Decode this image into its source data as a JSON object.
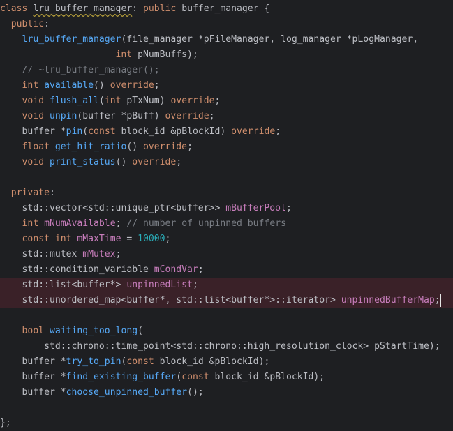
{
  "colors": {
    "background": "#1e1f22",
    "highlight_line": "#3a2128",
    "keyword": "#cf8e6d",
    "function": "#56a8f5",
    "field": "#c77dbb",
    "number": "#2aacb8",
    "comment": "#7a7e85",
    "plain": "#bcbec4"
  },
  "code": {
    "lines": [
      {
        "highlight": false,
        "tokens": [
          {
            "t": "class ",
            "k": "kw"
          },
          {
            "t": "lru_buffer_manager",
            "k": "plain",
            "u": true
          },
          {
            "t": ": ",
            "k": "plain"
          },
          {
            "t": "public ",
            "k": "kw"
          },
          {
            "t": "buffer_manager {",
            "k": "plain"
          }
        ]
      },
      {
        "highlight": false,
        "tokens": [
          {
            "t": "  ",
            "k": "plain"
          },
          {
            "t": "public",
            "k": "kw"
          },
          {
            "t": ":",
            "k": "plain"
          }
        ]
      },
      {
        "highlight": false,
        "tokens": [
          {
            "t": "    ",
            "k": "plain"
          },
          {
            "t": "lru_buffer_manager",
            "k": "fn"
          },
          {
            "t": "(file_manager *pFileManager, log_manager *pLogManager,",
            "k": "plain"
          }
        ]
      },
      {
        "highlight": false,
        "tokens": [
          {
            "t": "                     ",
            "k": "plain"
          },
          {
            "t": "int ",
            "k": "kw"
          },
          {
            "t": "pNumBuffs);",
            "k": "plain"
          }
        ]
      },
      {
        "highlight": false,
        "tokens": [
          {
            "t": "    ",
            "k": "plain"
          },
          {
            "t": "// ~lru_buffer_manager();",
            "k": "comment"
          }
        ]
      },
      {
        "highlight": false,
        "tokens": [
          {
            "t": "    ",
            "k": "plain"
          },
          {
            "t": "int ",
            "k": "kw"
          },
          {
            "t": "available",
            "k": "fn"
          },
          {
            "t": "() ",
            "k": "plain"
          },
          {
            "t": "override",
            "k": "kw"
          },
          {
            "t": ";",
            "k": "plain"
          }
        ]
      },
      {
        "highlight": false,
        "tokens": [
          {
            "t": "    ",
            "k": "plain"
          },
          {
            "t": "void ",
            "k": "kw"
          },
          {
            "t": "flush_all",
            "k": "fn"
          },
          {
            "t": "(",
            "k": "plain"
          },
          {
            "t": "int ",
            "k": "kw"
          },
          {
            "t": "pTxNum) ",
            "k": "plain"
          },
          {
            "t": "override",
            "k": "kw"
          },
          {
            "t": ";",
            "k": "plain"
          }
        ]
      },
      {
        "highlight": false,
        "tokens": [
          {
            "t": "    ",
            "k": "plain"
          },
          {
            "t": "void ",
            "k": "kw"
          },
          {
            "t": "unpin",
            "k": "fn"
          },
          {
            "t": "(buffer *pBuff) ",
            "k": "plain"
          },
          {
            "t": "override",
            "k": "kw"
          },
          {
            "t": ";",
            "k": "plain"
          }
        ]
      },
      {
        "highlight": false,
        "tokens": [
          {
            "t": "    ",
            "k": "plain"
          },
          {
            "t": "buffer *",
            "k": "plain"
          },
          {
            "t": "pin",
            "k": "fn"
          },
          {
            "t": "(",
            "k": "plain"
          },
          {
            "t": "const ",
            "k": "kw"
          },
          {
            "t": "block_id &pBlockId) ",
            "k": "plain"
          },
          {
            "t": "override",
            "k": "kw"
          },
          {
            "t": ";",
            "k": "plain"
          }
        ]
      },
      {
        "highlight": false,
        "tokens": [
          {
            "t": "    ",
            "k": "plain"
          },
          {
            "t": "float ",
            "k": "kw"
          },
          {
            "t": "get_hit_ratio",
            "k": "fn"
          },
          {
            "t": "() ",
            "k": "plain"
          },
          {
            "t": "override",
            "k": "kw"
          },
          {
            "t": ";",
            "k": "plain"
          }
        ]
      },
      {
        "highlight": false,
        "tokens": [
          {
            "t": "    ",
            "k": "plain"
          },
          {
            "t": "void ",
            "k": "kw"
          },
          {
            "t": "print_status",
            "k": "fn"
          },
          {
            "t": "() ",
            "k": "plain"
          },
          {
            "t": "override",
            "k": "kw"
          },
          {
            "t": ";",
            "k": "plain"
          }
        ]
      },
      {
        "highlight": false,
        "tokens": []
      },
      {
        "highlight": false,
        "tokens": [
          {
            "t": "  ",
            "k": "plain"
          },
          {
            "t": "private",
            "k": "kw"
          },
          {
            "t": ":",
            "k": "plain"
          }
        ]
      },
      {
        "highlight": false,
        "tokens": [
          {
            "t": "    ",
            "k": "plain"
          },
          {
            "t": "std::vector<std::unique_ptr<buffer>> ",
            "k": "plain"
          },
          {
            "t": "mBufferPool",
            "k": "field"
          },
          {
            "t": ";",
            "k": "plain"
          }
        ]
      },
      {
        "highlight": false,
        "tokens": [
          {
            "t": "    ",
            "k": "plain"
          },
          {
            "t": "int ",
            "k": "kw"
          },
          {
            "t": "mNumAvailable",
            "k": "field"
          },
          {
            "t": "; ",
            "k": "plain"
          },
          {
            "t": "// number of unpinned buffers",
            "k": "comment"
          }
        ]
      },
      {
        "highlight": false,
        "tokens": [
          {
            "t": "    ",
            "k": "plain"
          },
          {
            "t": "const int ",
            "k": "kw"
          },
          {
            "t": "mMaxTime",
            "k": "field"
          },
          {
            "t": " = ",
            "k": "plain"
          },
          {
            "t": "10000",
            "k": "num"
          },
          {
            "t": ";",
            "k": "plain"
          }
        ]
      },
      {
        "highlight": false,
        "tokens": [
          {
            "t": "    ",
            "k": "plain"
          },
          {
            "t": "std::mutex ",
            "k": "plain"
          },
          {
            "t": "mMutex",
            "k": "field"
          },
          {
            "t": ";",
            "k": "plain"
          }
        ]
      },
      {
        "highlight": false,
        "tokens": [
          {
            "t": "    ",
            "k": "plain"
          },
          {
            "t": "std::condition_variable ",
            "k": "plain"
          },
          {
            "t": "mCondVar",
            "k": "field"
          },
          {
            "t": ";",
            "k": "plain"
          }
        ]
      },
      {
        "highlight": true,
        "tokens": [
          {
            "t": "    ",
            "k": "plain"
          },
          {
            "t": "std::list<buffer*> ",
            "k": "plain"
          },
          {
            "t": "unpinnedList",
            "k": "field"
          },
          {
            "t": ";",
            "k": "plain"
          }
        ]
      },
      {
        "highlight": true,
        "caret": true,
        "tokens": [
          {
            "t": "    ",
            "k": "plain"
          },
          {
            "t": "std::unordered_map<buffer*, std::list<buffer*>::iterator> ",
            "k": "plain"
          },
          {
            "t": "unpinnedBufferMap",
            "k": "field"
          },
          {
            "t": ";",
            "k": "plain"
          }
        ]
      },
      {
        "highlight": false,
        "tokens": []
      },
      {
        "highlight": false,
        "tokens": [
          {
            "t": "    ",
            "k": "plain"
          },
          {
            "t": "bool ",
            "k": "kw"
          },
          {
            "t": "waiting_too_long",
            "k": "fn"
          },
          {
            "t": "(",
            "k": "plain"
          }
        ]
      },
      {
        "highlight": false,
        "tokens": [
          {
            "t": "        ",
            "k": "plain"
          },
          {
            "t": "std::chrono::time_point<std::chrono::high_resolution_clock> pStartTime);",
            "k": "plain"
          }
        ]
      },
      {
        "highlight": false,
        "tokens": [
          {
            "t": "    ",
            "k": "plain"
          },
          {
            "t": "buffer *",
            "k": "plain"
          },
          {
            "t": "try_to_pin",
            "k": "fn"
          },
          {
            "t": "(",
            "k": "plain"
          },
          {
            "t": "const ",
            "k": "kw"
          },
          {
            "t": "block_id &pBlockId);",
            "k": "plain"
          }
        ]
      },
      {
        "highlight": false,
        "tokens": [
          {
            "t": "    ",
            "k": "plain"
          },
          {
            "t": "buffer *",
            "k": "plain"
          },
          {
            "t": "find_existing_buffer",
            "k": "fn"
          },
          {
            "t": "(",
            "k": "plain"
          },
          {
            "t": "const ",
            "k": "kw"
          },
          {
            "t": "block_id &pBlockId);",
            "k": "plain"
          }
        ]
      },
      {
        "highlight": false,
        "tokens": [
          {
            "t": "    ",
            "k": "plain"
          },
          {
            "t": "buffer *",
            "k": "plain"
          },
          {
            "t": "choose_unpinned_buffer",
            "k": "fn"
          },
          {
            "t": "();",
            "k": "plain"
          }
        ]
      },
      {
        "highlight": false,
        "tokens": []
      },
      {
        "highlight": false,
        "tokens": [
          {
            "t": "};",
            "k": "plain"
          }
        ]
      }
    ]
  }
}
